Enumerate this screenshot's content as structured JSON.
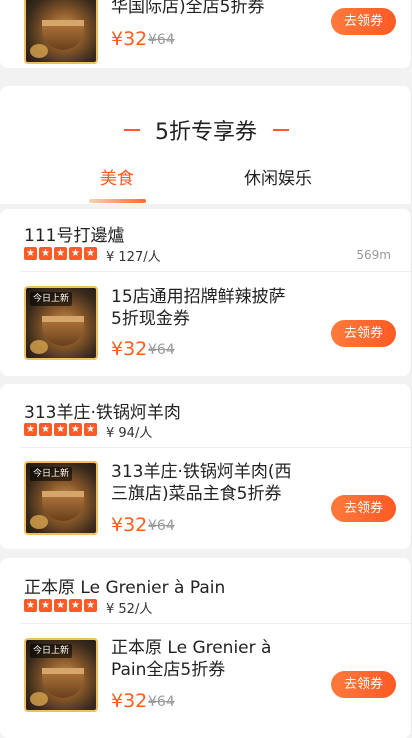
{
  "top_item": {
    "title": "华国际店)全店5折券",
    "badge": "今日上新",
    "price": "¥32",
    "orig_price": "¥64",
    "button": "去领券"
  },
  "section": {
    "title": "5折专享券",
    "tabs": [
      {
        "label": "美食",
        "active": true
      },
      {
        "label": "休闲娱乐",
        "active": false
      }
    ]
  },
  "stores": [
    {
      "name": "111号打邊爐",
      "rating_stars": 5,
      "per_person": "¥ 127/人",
      "distance": "569m",
      "coupon": {
        "badge": "今日上新",
        "title_line1": "15店通用招牌鲜辣披萨",
        "title_line2": "5折现金券",
        "price": "¥32",
        "orig_price": "¥64",
        "button": "去领券"
      }
    },
    {
      "name": "313羊庄·铁锅炣羊肉",
      "rating_stars": 5,
      "per_person": "¥ 94/人",
      "distance": "",
      "coupon": {
        "badge": "今日上新",
        "title_line1": "313羊庄·铁锅炣羊肉(西",
        "title_line2": "三旗店)菜品主食5折券",
        "price": "¥32",
        "orig_price": "¥64",
        "button": "去领券"
      }
    },
    {
      "name": "正本原 Le Grenier à Pain",
      "rating_stars": 5,
      "per_person": "¥ 52/人",
      "distance": "",
      "coupon": {
        "badge": "今日上新",
        "title_line1": "正本原 Le Grenier à",
        "title_line2": "Pain全店5折券",
        "price": "¥32",
        "orig_price": "¥64",
        "button": "去领券"
      }
    }
  ],
  "colors": {
    "accent": "#ff5a24",
    "thumb_border": "#f0c060"
  },
  "icons": {
    "star": "star-icon"
  }
}
